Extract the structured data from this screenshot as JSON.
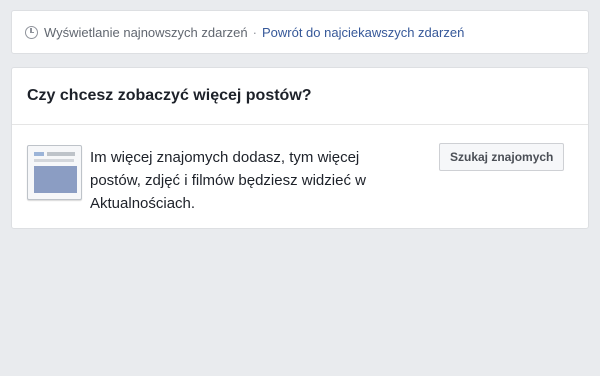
{
  "sort_bar": {
    "icon": "clock-icon",
    "current_label": "Wyświetlanie najnowszych zdarzeń",
    "separator": "·",
    "switch_link": "Powrót do najciekawszych zdarzeń"
  },
  "card": {
    "title": "Czy chcesz zobaczyć więcej postów?",
    "icon": "news-feed-illustration-icon",
    "message": "Im więcej znajomych dodasz, tym więcej postów, zdjęć i filmów będziesz widzieć w Aktualnościach.",
    "button_label": "Szukaj znajomych"
  },
  "colors": {
    "background": "#e9ebee",
    "link": "#365899",
    "text": "#1d2129",
    "muted": "#616770"
  }
}
